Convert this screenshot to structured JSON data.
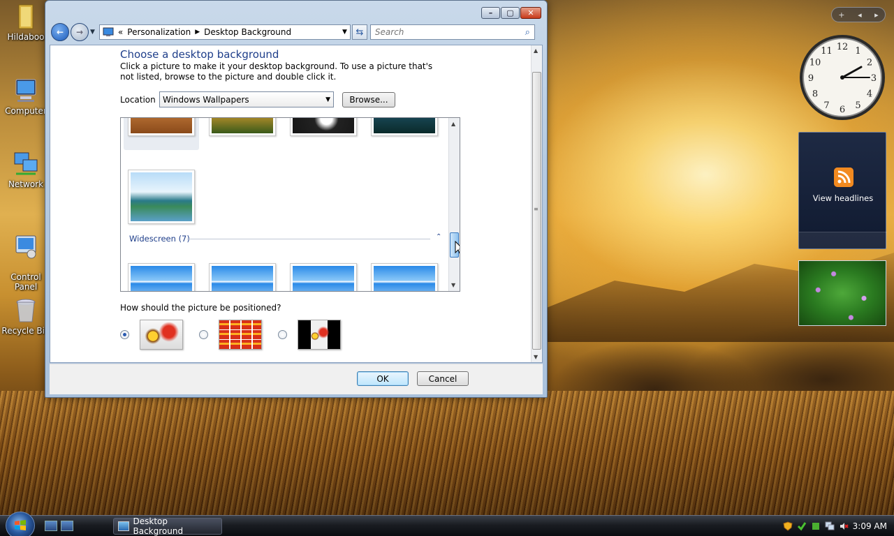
{
  "desktop": {
    "icons": [
      {
        "label": "Hildaboo"
      },
      {
        "label": "Computer"
      },
      {
        "label": "Network"
      },
      {
        "label": "Control\nPanel"
      },
      {
        "label": "Recycle Bin"
      }
    ]
  },
  "window": {
    "controls": {
      "minimize": "–",
      "maximize": "▢",
      "close": "✕"
    },
    "breadcrumb": {
      "root": "«",
      "items": [
        "Personalization",
        "Desktop Background"
      ]
    },
    "search": {
      "placeholder": "Search"
    },
    "page": {
      "title": "Choose a desktop background",
      "description": "Click a picture to make it your desktop background. To use a picture that's not listed, browse to the picture and double click it.",
      "location_label": "Location",
      "location_value": "Windows Wallpapers",
      "browse_label": "Browse...",
      "group_label": "Widescreen (7)",
      "position_question": "How should the picture be positioned?"
    },
    "footer": {
      "ok_label": "OK",
      "cancel_label": "Cancel"
    }
  },
  "gadgets": {
    "clock_numbers": [
      "12",
      "1",
      "2",
      "3",
      "4",
      "5",
      "6",
      "7",
      "8",
      "9",
      "10",
      "11"
    ],
    "feed_label": "View headlines"
  },
  "taskbar": {
    "task_label": "Desktop Background",
    "time": "3:09 AM"
  },
  "colors": {
    "link_blue": "#1e3e8a",
    "window_frame": "#b6cbe2",
    "taskbar": "#1a1d22"
  }
}
